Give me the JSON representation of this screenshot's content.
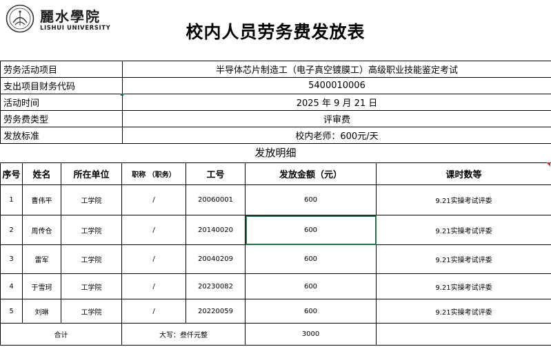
{
  "logo": {
    "cn": "麗水學院",
    "en": "LISHUI UNIVERSITY",
    "icon": "university-emblem-icon"
  },
  "title": "校内人员劳务费发放表",
  "info": [
    {
      "label": "劳务活动项目",
      "value": "半导体芯片制造工（电子真空镀膜工）高级职业技能鉴定考试"
    },
    {
      "label": "支出项目财务代码",
      "value": "5400010006"
    },
    {
      "label": "活动时间",
      "value": "2025 年 9 月 21 日"
    },
    {
      "label": "劳务费类型",
      "value": "评审费"
    },
    {
      "label": "发放标准",
      "value": "校内老师：600元/天"
    }
  ],
  "section_title": "发放明细",
  "columns": [
    "序号",
    "姓名",
    "所在单位",
    "职称 （职务）",
    "工号",
    "发放金额（元）",
    "课时数等"
  ],
  "rows": [
    {
      "no": "1",
      "name": "曹伟平",
      "unit": "工学院",
      "title": "/",
      "id": "20060001",
      "amount": "600",
      "hours": "9.21实操考试评委"
    },
    {
      "no": "2",
      "name": "周传仓",
      "unit": "工学院",
      "title": "/",
      "id": "20140020",
      "amount": "600",
      "hours": "9.21实操考试评委"
    },
    {
      "no": "3",
      "name": "雷军",
      "unit": "工学院",
      "title": "/",
      "id": "20040209",
      "amount": "600",
      "hours": "9.21实操考试评委"
    },
    {
      "no": "4",
      "name": "于雪珂",
      "unit": "工学院",
      "title": "/",
      "id": "20230082",
      "amount": "600",
      "hours": "9.21实操考试评委"
    },
    {
      "no": "5",
      "name": "刘琳",
      "unit": "工学院",
      "title": "/",
      "id": "20220059",
      "amount": "600",
      "hours": "9.21实操考试评委"
    }
  ],
  "total": {
    "label": "合计",
    "uppercase": "大写：叁仟元整",
    "amount": "3000"
  },
  "colors": {
    "selection": "#1e7145",
    "comment_marker": "#c0392b"
  }
}
